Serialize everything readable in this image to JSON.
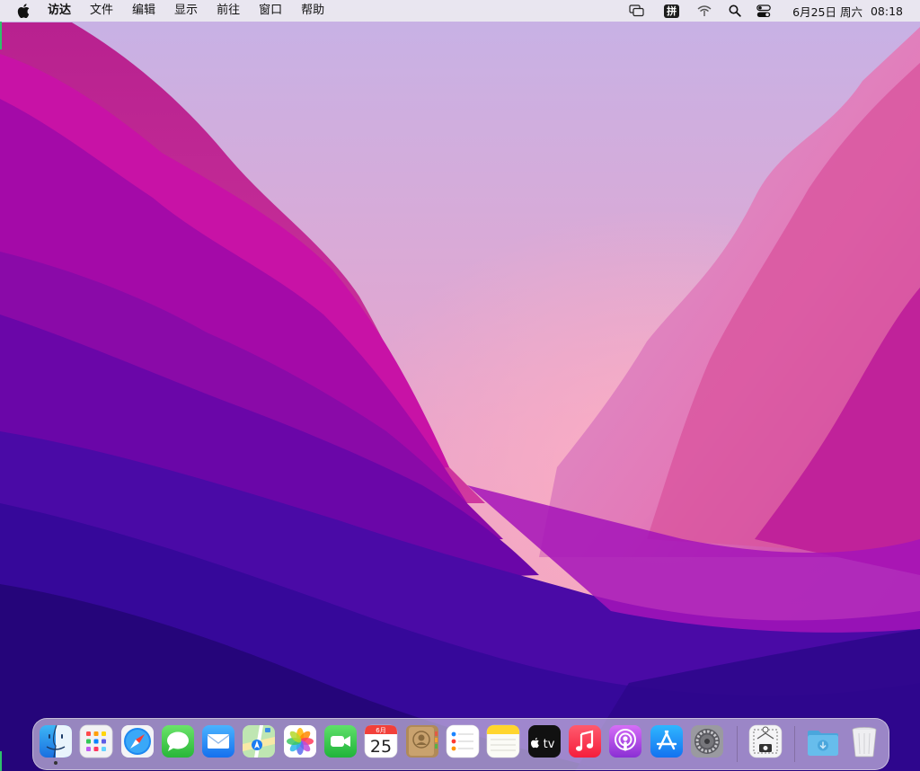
{
  "menubar": {
    "app_name": "访达",
    "menus": [
      "文件",
      "编辑",
      "显示",
      "前往",
      "窗口",
      "帮助"
    ],
    "input_method": "拼",
    "date": "6月25日 周六",
    "time": "08:18"
  },
  "dock": {
    "apps": [
      {
        "name": "finder",
        "running": true
      },
      {
        "name": "launchpad"
      },
      {
        "name": "safari"
      },
      {
        "name": "messages"
      },
      {
        "name": "mail"
      },
      {
        "name": "maps"
      },
      {
        "name": "photos"
      },
      {
        "name": "facetime"
      },
      {
        "name": "calendar"
      },
      {
        "name": "contacts"
      },
      {
        "name": "reminders"
      },
      {
        "name": "notes"
      },
      {
        "name": "apple-tv"
      },
      {
        "name": "music"
      },
      {
        "name": "podcasts"
      },
      {
        "name": "app-store"
      },
      {
        "name": "system-preferences"
      },
      {
        "name": "screenshot-utility"
      },
      {
        "name": "downloads-folder"
      },
      {
        "name": "trash"
      }
    ],
    "calendar_month": "6月",
    "calendar_day": "25",
    "tv_label": "tv"
  }
}
